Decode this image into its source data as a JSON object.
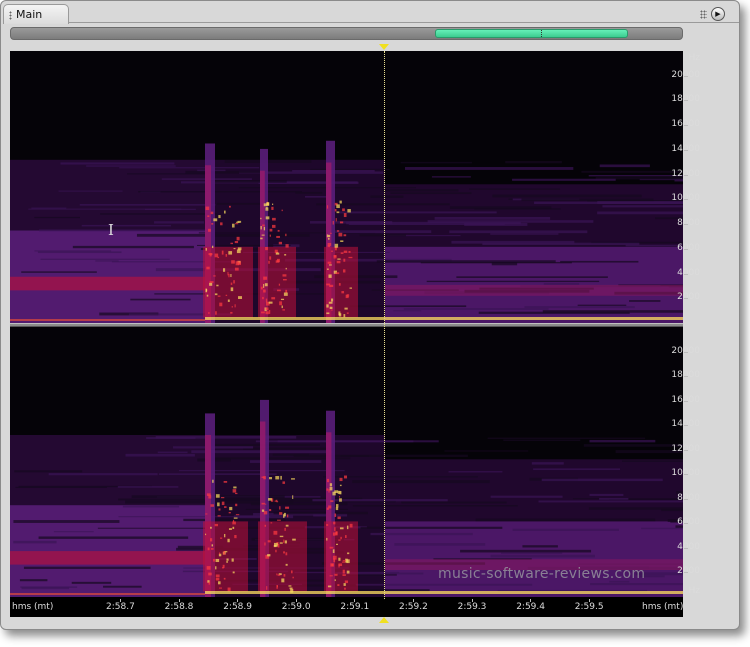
{
  "window": {
    "tab_label": "Main",
    "grip_icon": "grip-dots-icon",
    "play_icon": "play-circle-icon",
    "play_glyph": "▶"
  },
  "overview": {
    "view_start": 0.632,
    "view_end": 0.92,
    "cursor": 0.79
  },
  "colors": {
    "frame": "#d8d8d8",
    "background": "#000000",
    "overview_range": "#4ce0a0",
    "marker": "#f0e020",
    "spectral_low": "#2a0a3a",
    "spectral_mid": "#5a1e7a",
    "spectral_high": "#c0103a",
    "spectral_peak": "#ffe060"
  },
  "spectral_display": {
    "frequency_unit": "Hz",
    "frequency_max": 22000,
    "frequency_ticks_top": [
      "20000",
      "18000",
      "16000",
      "14000",
      "12000",
      "10000",
      "8000",
      "6000",
      "4000",
      "2000"
    ],
    "frequency_ticks_bottom": [
      "20000",
      "18000",
      "16000",
      "14000",
      "12000",
      "10000",
      "8000",
      "6000",
      "4000",
      "2000"
    ],
    "time_ruler": {
      "unit_label": "hms (mt)",
      "unit_label_right": "hms (mt)",
      "ticks": [
        "2:58.7",
        "2:58.8",
        "2:58.9",
        "2:59.0",
        "2:59.1",
        "2:59.2",
        "2:59.3",
        "2:59.4",
        "2:59.5"
      ]
    },
    "watermark": "music-software-reviews.com"
  }
}
